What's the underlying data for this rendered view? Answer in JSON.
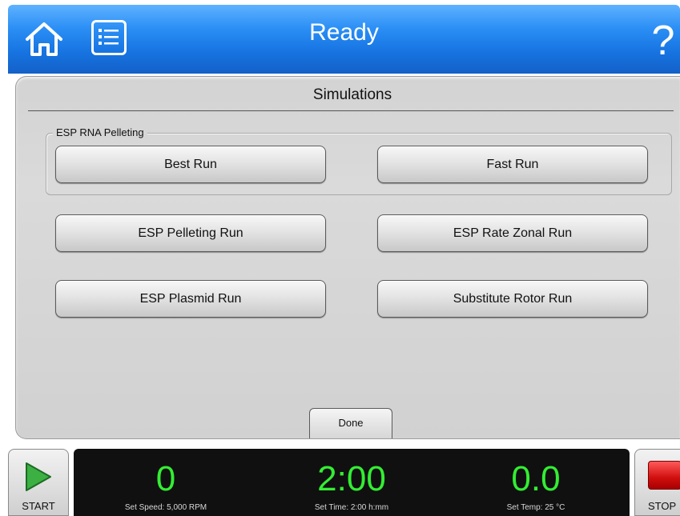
{
  "header": {
    "status_title": "Ready",
    "home_icon": "home-icon",
    "menu_icon": "list-menu-icon",
    "help_label": "?"
  },
  "panel": {
    "title": "Simulations",
    "group_label": "ESP RNA Pelleting",
    "buttons": [
      "Best Run",
      "Fast Run",
      "ESP Pelleting Run",
      "ESP Rate Zonal Run",
      "ESP Plasmid Run",
      "Substitute Rotor Run"
    ],
    "done_label": "Done"
  },
  "footer": {
    "start_label": "START",
    "stop_label": "STOP",
    "speed": {
      "value": "0",
      "setpoint": "Set Speed: 5,000 RPM"
    },
    "time": {
      "value": "2:00",
      "setpoint": "Set Time: 2:00 h:mm"
    },
    "temp": {
      "value": "0.0",
      "setpoint": "Set Temp: 25 °C"
    }
  },
  "colors": {
    "header_blue": "#1a78e6",
    "readout_green": "#33ee33",
    "start_green": "#3cb043",
    "stop_red": "#e01a1a"
  }
}
